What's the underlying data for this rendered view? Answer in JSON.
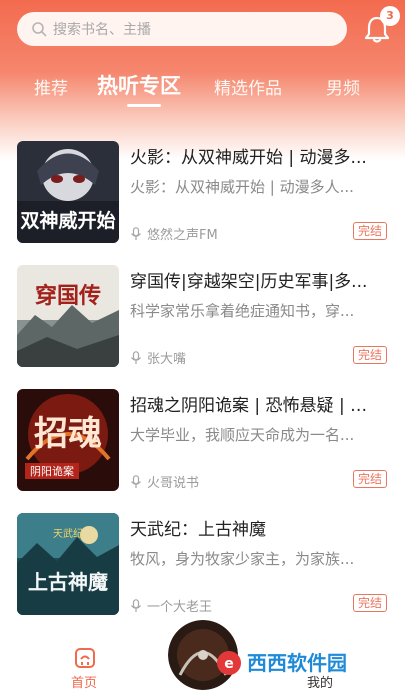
{
  "search": {
    "placeholder": "搜索书名、主播"
  },
  "notifications": {
    "count": "3"
  },
  "tabs": [
    {
      "label": "推荐"
    },
    {
      "label": "热听专区"
    },
    {
      "label": "精选作品"
    },
    {
      "label": "男频"
    }
  ],
  "active_tab": "热听专区",
  "items": [
    {
      "title": "火影：从双神威开始 | 动漫多...",
      "desc": "火影：从双神威开始 | 动漫多人...",
      "host": "悠然之声FM",
      "status": "完结",
      "cover_text": "双神威开始"
    },
    {
      "title": "穿国传|穿越架空|历史军事|多...",
      "desc": "科学家常乐拿着绝症通知书，穿...",
      "host": "张大嘴",
      "status": "完结",
      "cover_text": "穿国传"
    },
    {
      "title": "招魂之阴阳诡案 | 恐怖悬疑 | 多...",
      "desc": "大学毕业，我顺应天命成为一名...",
      "host": "火哥说书",
      "status": "完结",
      "cover_text": "招魂",
      "cover_subtext": "阴阳诡案"
    },
    {
      "title": "天武纪：上古神魔",
      "desc": "牧风，身为牧家少家主，为家族...",
      "host": "一个大老王",
      "status": "完结",
      "cover_text": "上古神魔",
      "cover_subtext": "天武纪"
    }
  ],
  "bottom_nav": {
    "home": "首页",
    "me": "我的"
  },
  "watermark": "西西软件园"
}
